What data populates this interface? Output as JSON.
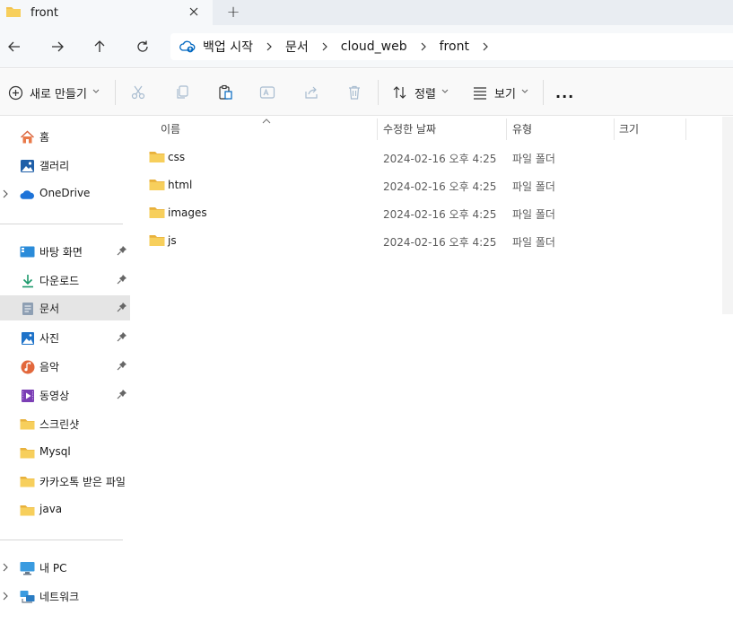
{
  "window": {
    "tab_title": "front",
    "new_tab_symbol": "+"
  },
  "breadcrumb": {
    "items": [
      "백업 시작",
      "문서",
      "cloud_web",
      "front"
    ]
  },
  "toolbar": {
    "new_label": "새로 만들기",
    "sort_label": "정렬",
    "view_label": "보기",
    "more_label": "..."
  },
  "sidebar": {
    "home": "홈",
    "gallery": "갤러리",
    "onedrive": "OneDrive",
    "pinned": [
      {
        "label": "바탕 화면",
        "icon": "desktop-icon"
      },
      {
        "label": "다운로드",
        "icon": "download-icon"
      },
      {
        "label": "문서",
        "icon": "documents-icon"
      },
      {
        "label": "사진",
        "icon": "pictures-icon"
      },
      {
        "label": "음악",
        "icon": "music-icon"
      },
      {
        "label": "동영상",
        "icon": "videos-icon"
      }
    ],
    "folders": [
      "스크린샷",
      "Mysql",
      "카카오톡 받은 파일",
      "java"
    ],
    "this_pc": "내 PC",
    "network": "네트워크"
  },
  "columns": {
    "name": "이름",
    "modified": "수정한 날짜",
    "type": "유형",
    "size": "크기"
  },
  "files": [
    {
      "name": "css",
      "modified": "2024-02-16 오후 4:25",
      "type": "파일 폴더"
    },
    {
      "name": "html",
      "modified": "2024-02-16 오후 4:25",
      "type": "파일 폴더"
    },
    {
      "name": "images",
      "modified": "2024-02-16 오후 4:25",
      "type": "파일 폴더"
    },
    {
      "name": "js",
      "modified": "2024-02-16 오후 4:25",
      "type": "파일 폴더"
    }
  ],
  "colors": {
    "folder": "#f2c14e",
    "accent": "#0067c0",
    "selected_bg": "#e5e5e5"
  }
}
